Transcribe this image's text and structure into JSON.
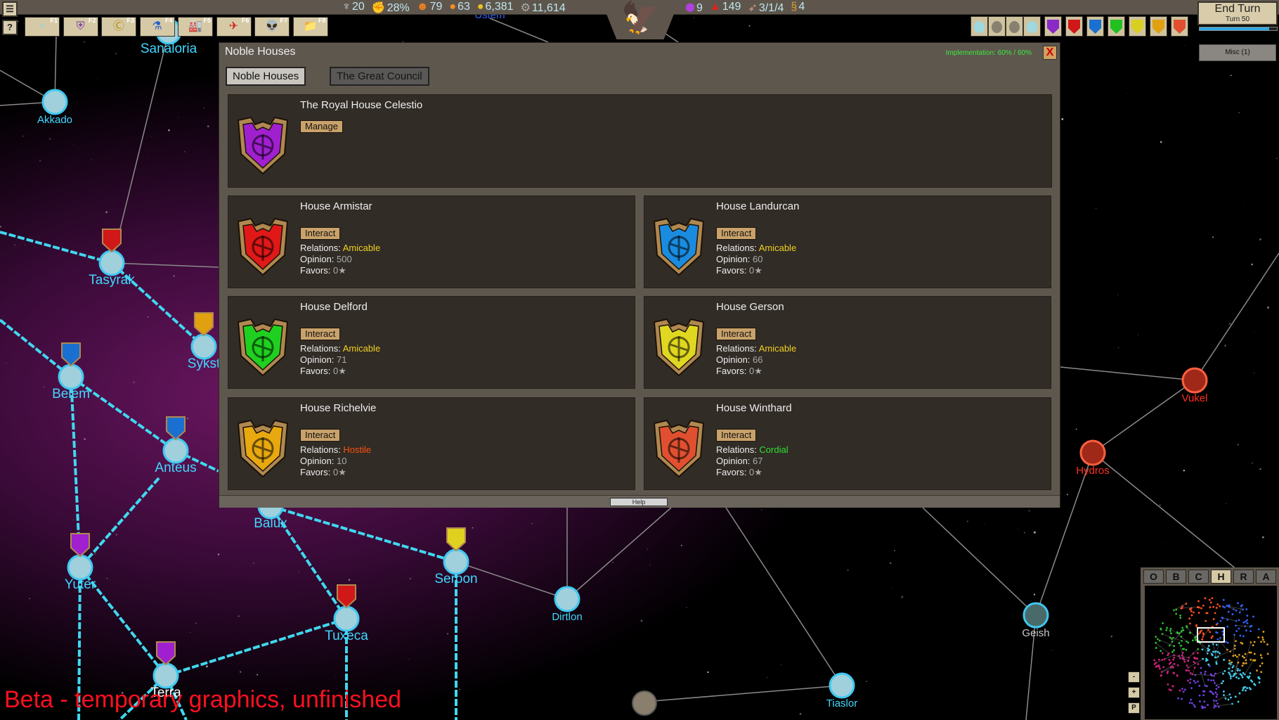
{
  "top_stats_left": [
    {
      "icon": "eagle-icon",
      "glyph": "♆",
      "value": "20",
      "color": "#c8d8e8"
    },
    {
      "icon": "fist-icon",
      "glyph": "✊",
      "value": "28%",
      "color": "#e04020"
    },
    {
      "icon": "person-icon",
      "glyph": "☻",
      "value": "79",
      "color": "#f08020"
    },
    {
      "icon": "food-icon",
      "glyph": "●",
      "value": "63",
      "color": "#f09020"
    },
    {
      "icon": "coin-icon",
      "glyph": "●",
      "value": "6,381",
      "color": "#e8c020"
    },
    {
      "icon": "gear-icon",
      "glyph": "⚙",
      "value": "11,614",
      "color": "#aaaaaa"
    }
  ],
  "top_stats_right": [
    {
      "icon": "crystal-icon",
      "glyph": "⬢",
      "value": "9",
      "color": "#b040e0"
    },
    {
      "icon": "alert-icon",
      "glyph": "▲",
      "value": "149",
      "color": "#e02020"
    },
    {
      "icon": "rocket-icon",
      "glyph": "➶",
      "value": "3/1/4",
      "color": "#d0a080"
    },
    {
      "icon": "influence-icon",
      "glyph": "§",
      "value": "4",
      "color": "#e0a030"
    }
  ],
  "toolbar": [
    {
      "name": "empire",
      "key": "F1",
      "glyph": "♆",
      "color": "#8fd0e8"
    },
    {
      "name": "military",
      "key": "F2",
      "glyph": "⛨",
      "color": "#7a3aa0"
    },
    {
      "name": "economy",
      "key": "F3",
      "glyph": "Ⓒ",
      "color": "#b08a00"
    },
    {
      "name": "research",
      "key": "F4",
      "glyph": "⚗",
      "color": "#2060d0"
    },
    {
      "name": "industry",
      "key": "F5",
      "glyph": "🏭",
      "color": "#a04010"
    },
    {
      "name": "fleets",
      "key": "F6",
      "glyph": "✈",
      "color": "#d02020"
    },
    {
      "name": "aliens",
      "key": "F7",
      "glyph": "👽",
      "color": "#20a020"
    },
    {
      "name": "files",
      "key": "F8",
      "glyph": "📁",
      "color": "#e0c040"
    }
  ],
  "side_buttons": {
    "menu": "☰",
    "help": "?"
  },
  "house_banners": [
    "#8a28c8",
    "#d01818",
    "#1a70d0",
    "#20c020",
    "#d8d020",
    "#e0a010",
    "#e05030"
  ],
  "planet_buttons": [
    "planet-1",
    "planet-2",
    "planet-3",
    "planet-capital"
  ],
  "end_turn": {
    "label": "End Turn",
    "turn": "Turn 50",
    "progress": 0.9
  },
  "misc_label": "Misc (1)",
  "dialog": {
    "title": "Noble Houses",
    "implementation": "Implementation: 60% / 60%",
    "close": "X",
    "tabs": [
      {
        "label": "Noble Houses",
        "active": true
      },
      {
        "label": "The Great Council",
        "active": false
      }
    ],
    "royal": {
      "name": "The Royal House Celestio",
      "button": "Manage",
      "color": "#a020d0"
    },
    "relations_label": "Relations: ",
    "opinion_label": "Opinion: ",
    "favors_label": "Favors: ",
    "houses": [
      {
        "name": "House Armistar",
        "button": "Interact",
        "relation": "Amicable",
        "relation_color": "#f0d020",
        "opinion": "500",
        "favors": "0",
        "color": "#e01818"
      },
      {
        "name": "House Landurcan",
        "button": "Interact",
        "relation": "Amicable",
        "relation_color": "#f0d020",
        "opinion": "60",
        "favors": "0",
        "color": "#1a8ce0"
      },
      {
        "name": "House Delford",
        "button": "Interact",
        "relation": "Amicable",
        "relation_color": "#f0d020",
        "opinion": "71",
        "favors": "0",
        "color": "#20d020"
      },
      {
        "name": "House Gerson",
        "button": "Interact",
        "relation": "Amicable",
        "relation_color": "#f0d020",
        "opinion": "66",
        "favors": "0",
        "color": "#e0d820"
      },
      {
        "name": "House Richelvie",
        "button": "Interact",
        "relation": "Hostile",
        "relation_color": "#ff5010",
        "opinion": "10",
        "favors": "0",
        "color": "#e8a810"
      },
      {
        "name": "House Winthard",
        "button": "Interact",
        "relation": "Cordial",
        "relation_color": "#30e030",
        "opinion": "67",
        "favors": "0",
        "color": "#e05030"
      }
    ],
    "help": "Help"
  },
  "map": {
    "systems": [
      {
        "name": "Akkado",
        "color": "#40d8ff"
      },
      {
        "name": "Sanaloria",
        "color": "#40d8ff"
      },
      {
        "name": "Tasyrak",
        "color": "#40d8ff"
      },
      {
        "name": "Sykst",
        "color": "#40d8ff"
      },
      {
        "name": "Belem",
        "color": "#40d8ff"
      },
      {
        "name": "Anteus",
        "color": "#40d8ff"
      },
      {
        "name": "Balux",
        "color": "#40d8ff"
      },
      {
        "name": "Yuter",
        "color": "#40d8ff"
      },
      {
        "name": "Seroon",
        "color": "#40d8ff"
      },
      {
        "name": "Dirtlon",
        "color": "#40d8ff"
      },
      {
        "name": "Tuxeca",
        "color": "#40d8ff"
      },
      {
        "name": "Terra",
        "color": "#ffffff"
      },
      {
        "name": "Geish",
        "color": "#cccccc"
      },
      {
        "name": "Tiaslor",
        "color": "#40d8ff"
      },
      {
        "name": "Vukel",
        "color": "#ff3020"
      },
      {
        "name": "Hydros",
        "color": "#ff3020"
      },
      {
        "name": "Ustem",
        "color": "#3060ff"
      }
    ]
  },
  "minimap": {
    "tabs": [
      "O",
      "B",
      "C",
      "H",
      "R",
      "A"
    ],
    "active": "H",
    "zoom_out": "-",
    "zoom_in": "+",
    "p": "P"
  },
  "beta_notice": "Beta - temporary graphics, unfinished"
}
